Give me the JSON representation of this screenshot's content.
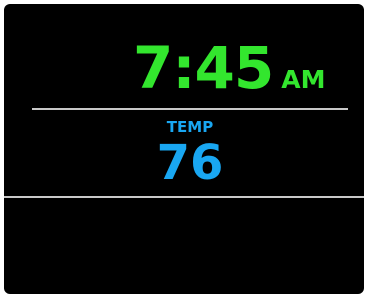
{
  "clock": {
    "time": "7:45",
    "ampm": "AM",
    "color": "#33e62e"
  },
  "temperature": {
    "label": "TEMP",
    "value": "76",
    "color": "#19a7f2"
  },
  "theme": {
    "background": "#000000",
    "divider": "#c8c8c8"
  }
}
